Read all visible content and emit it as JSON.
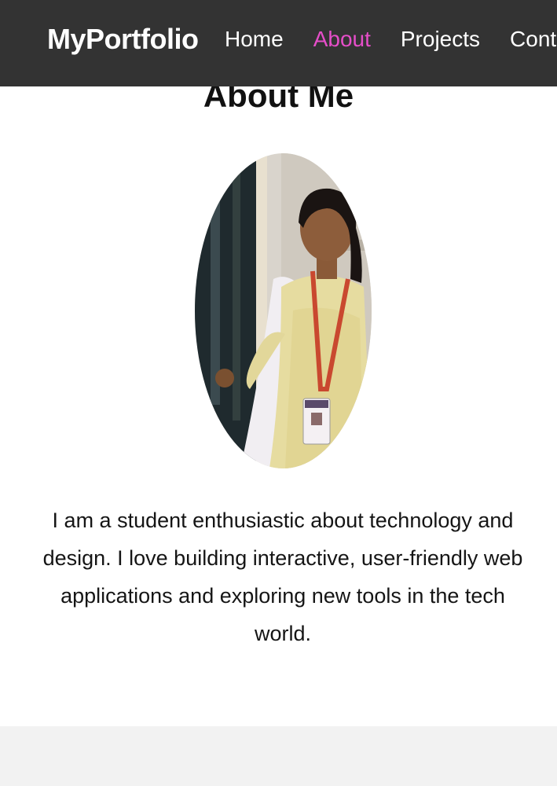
{
  "nav": {
    "brand": "MyPortfolio",
    "links": [
      {
        "label": "Home"
      },
      {
        "label": "About"
      },
      {
        "label": "Projects"
      },
      {
        "label": "Contact"
      }
    ],
    "active_color": "#e64ec9",
    "background": "#333333"
  },
  "about": {
    "title": "About Me",
    "description": "I am a student enthusiastic about technology and design. I love building interactive, user-friendly web applications and exploring new tools in the tech world.",
    "photo_icon": "profile-photo"
  }
}
